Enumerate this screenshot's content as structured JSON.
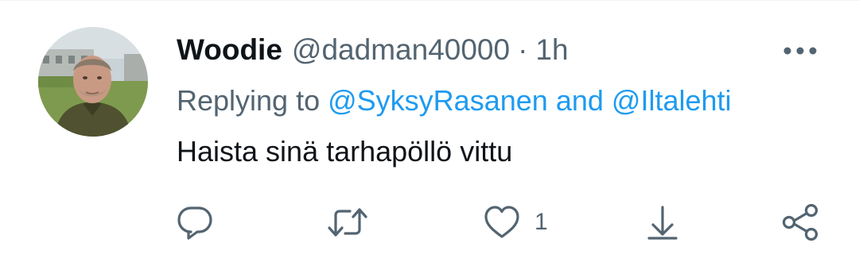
{
  "tweet": {
    "author": {
      "display_name": "Woodie",
      "handle": "@dadman40000"
    },
    "separator": "·",
    "time": "1h",
    "replying_to": {
      "prefix": "Replying to",
      "mention_1": "@SyksyRasanen",
      "conjunction": "and",
      "mention_2": "@Iltalehti"
    },
    "text": "Haista sinä tarhapöllö vittu",
    "actions": {
      "reply_icon": "speech-bubble-icon",
      "retweet_icon": "retweet-arrows-icon",
      "like_icon": "heart-icon",
      "like_count": "1",
      "download_icon": "arrow-down-icon",
      "share_icon": "share-nodes-icon"
    },
    "more_icon": "three-dots-icon"
  },
  "colors": {
    "text_primary": "#0f1419",
    "text_secondary": "#536471",
    "mention": "#1d9bf0",
    "background": "#ffffff"
  }
}
